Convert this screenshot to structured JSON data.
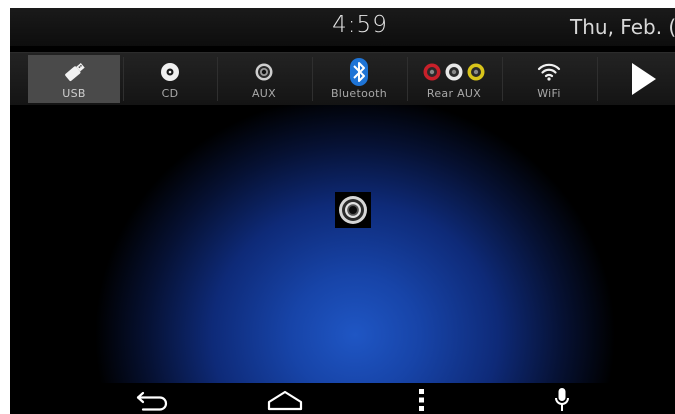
{
  "status": {
    "time": "4:59",
    "date": "Thu, Feb. ("
  },
  "sources": [
    {
      "label": "USB",
      "icon": "usb-icon",
      "active": true
    },
    {
      "label": "CD",
      "icon": "cd-icon",
      "active": false
    },
    {
      "label": "AUX",
      "icon": "aux-jack-icon",
      "active": false
    },
    {
      "label": "Bluetooth",
      "icon": "bluetooth-icon",
      "active": false
    },
    {
      "label": "Rear AUX",
      "icon": "rca-jacks-icon",
      "active": false
    },
    {
      "label": "WiFi",
      "icon": "wifi-icon",
      "active": false
    }
  ],
  "colors": {
    "bluetooth": "#1e74d6",
    "rca_red": "#c8202a",
    "rca_white": "#e8e8e8",
    "rca_yellow": "#d8c41a",
    "active_tab": "#4a4a4a",
    "glow": "#1f56c4"
  },
  "main": {
    "center_icon": "aux-jack-icon"
  },
  "navbar": {
    "icons": [
      "back-icon",
      "home-icon",
      "menu-icon",
      "microphone-icon"
    ]
  }
}
